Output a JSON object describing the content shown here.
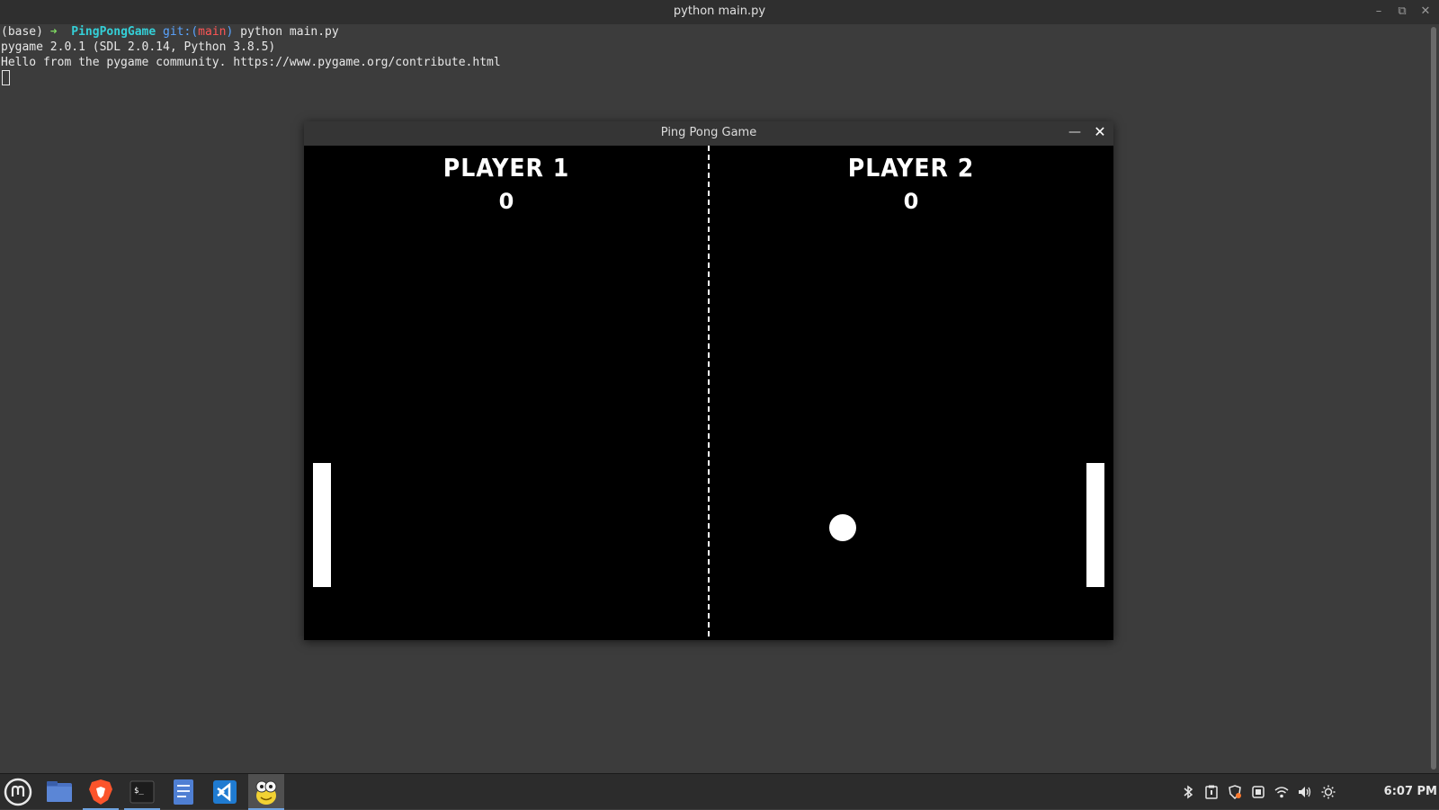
{
  "terminal": {
    "title": "python main.py",
    "prompt_base": "(base)",
    "prompt_arrow": "➜",
    "prompt_dir": "PingPongGame",
    "prompt_git": "git:(",
    "prompt_branch": "main",
    "prompt_git_close": ")",
    "prompt_command": "python main.py",
    "output_line1": "pygame 2.0.1 (SDL 2.0.14, Python 3.8.5)",
    "output_line2": "Hello from the pygame community. https://www.pygame.org/contribute.html"
  },
  "game_window": {
    "title": "Ping Pong Game",
    "player1_label": "PLAYER 1",
    "player2_label": "PLAYER 2",
    "player1_score": "0",
    "player2_score": "0"
  },
  "taskbar": {
    "apps": [
      "mint-menu-icon",
      "files-icon",
      "brave-browser-icon",
      "terminal-icon",
      "text-editor-icon",
      "vscode-icon",
      "pygame-icon"
    ],
    "clock": "6:07 PM"
  },
  "colors": {
    "terminal_bg": "#3c3c3c",
    "prompt_green": "#7fd962",
    "prompt_cyan": "#34d0d8",
    "prompt_blue": "#5aa4ff",
    "prompt_red": "#ff5555",
    "game_bg": "#000000",
    "game_fg": "#ffffff"
  }
}
